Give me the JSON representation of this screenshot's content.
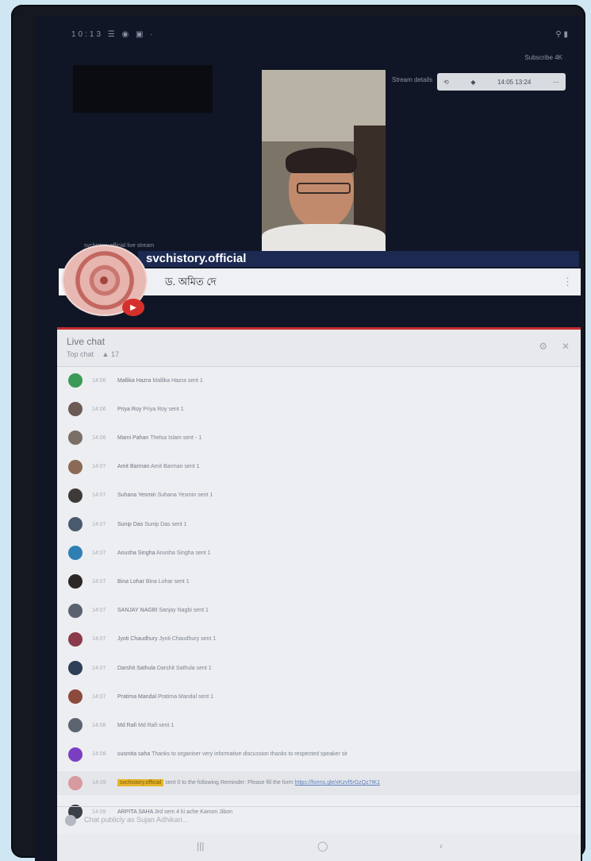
{
  "status_bar": {
    "left_icons": "10:13 ☰ ◉ ▣ ·",
    "right_icons": "⚲ ▮"
  },
  "toolbar": {
    "corner_text": "Subscribe 4K",
    "meta_text": "Stream details",
    "controls": [
      "⟲",
      "◆",
      "14:05 13:24",
      "⋯"
    ]
  },
  "channel": {
    "small_caption": "svchistory.official live stream",
    "name": "svchistory.official",
    "subtitle": "ড. অমিত দে",
    "badge_icon": "youtube-icon"
  },
  "chat": {
    "title": "Live chat",
    "tabs": [
      "Top chat",
      "▲ 17"
    ],
    "messages": [
      {
        "time": "14:06",
        "author": "Mallika Hazra",
        "text": "Mallika Hazra sent 1",
        "avatar_color": "#3b9a55"
      },
      {
        "time": "14:06",
        "author": "Priya Roy",
        "text": "Priya Roy sent 1",
        "avatar_color": "#6b5b54"
      },
      {
        "time": "14:06",
        "author": "Mami Pahan",
        "text": "Thelsa Islam sent - 1",
        "avatar_color": "#7b6e67"
      },
      {
        "time": "14:07",
        "author": "Amit Barman",
        "text": "Amit Barman sent 1",
        "avatar_color": "#8b6a55"
      },
      {
        "time": "14:07",
        "author": "Suhana Yesmin",
        "text": "Suhana Yesmin sent 1",
        "avatar_color": "#3f3a3a"
      },
      {
        "time": "14:07",
        "author": "Sunip Das",
        "text": "Sunip Das sent 1",
        "avatar_color": "#4a5a6e"
      },
      {
        "time": "14:07",
        "author": "Anusha Singha",
        "text": "Anusha Singha sent 1",
        "avatar_color": "#2f7fb5"
      },
      {
        "time": "14:07",
        "author": "Bina Lohar",
        "text": "Bina Lohar sent 1",
        "avatar_color": "#2c2727"
      },
      {
        "time": "14:07",
        "author": "SANJAY NAGBI",
        "text": "Sanjay Nagbi sent 1",
        "avatar_color": "#5a6170"
      },
      {
        "time": "14:07",
        "author": "Jyoti Chaudhury",
        "text": "Jyoti Chaudhury sent 1",
        "avatar_color": "#8a3a4a"
      },
      {
        "time": "14:07",
        "author": "Darshit Sathula",
        "text": "Darshit Sathula sent 1",
        "avatar_color": "#2d3f56"
      },
      {
        "time": "14:07",
        "author": "Pratima Mandal",
        "text": "Pratima Mandal sent 1",
        "avatar_color": "#8b4a3a"
      },
      {
        "time": "14:08",
        "author": "Md Rafi",
        "text": "Md Rafi sent 1",
        "avatar_color": "#5c6470"
      },
      {
        "time": "14:08",
        "author": "susmita saha",
        "text": "Thanks to organiser very informative discussion thanks to respected speaker sir",
        "avatar_color": "#7b3fc2"
      },
      {
        "time": "14:09",
        "author": "svchistory.official",
        "text": "sent 0 to the following Reminder: Please fill the form",
        "link": "https://forms.gle/xKzvf5rGzQz7tK1",
        "avatar_color": "#d79aa0",
        "owner": true
      },
      {
        "time": "14:09",
        "author": "ARPITA SAHA",
        "text": "3rd sem 4 ki ache Kamon Jibon",
        "avatar_color": "#3a3f48"
      }
    ],
    "input_placeholder": "Chat publicly as Sujan Adhikari..."
  },
  "nav": {
    "recent": "|||",
    "home": "◯",
    "back": "‹"
  }
}
